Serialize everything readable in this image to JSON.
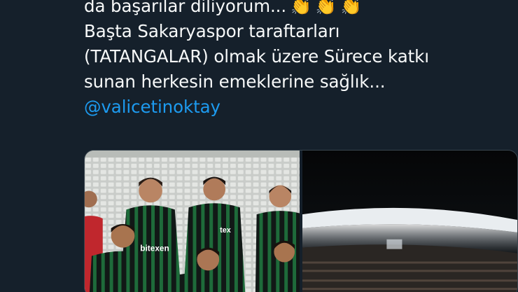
{
  "tweet": {
    "lines": [
      "da başarılar diliyorum...",
      "Başta Sakaryaspor taraftarları",
      "(TATANGALAR) olmak üzere Sürece katkı",
      "sunan herkesin emeklerine sağlık..."
    ],
    "claps": [
      "👏",
      "👏",
      "👏"
    ],
    "mention": "@valicetinoktay"
  },
  "media": {
    "photo1": {
      "jersey_sponsor": "bitexen",
      "jersey_sponsor_short": "tex"
    },
    "photo2": {}
  },
  "colors": {
    "background": "#15202b",
    "text": "#f7f9f9",
    "link": "#1d9bf0",
    "border": "#38444d",
    "team_green": "#1e6b3a"
  }
}
